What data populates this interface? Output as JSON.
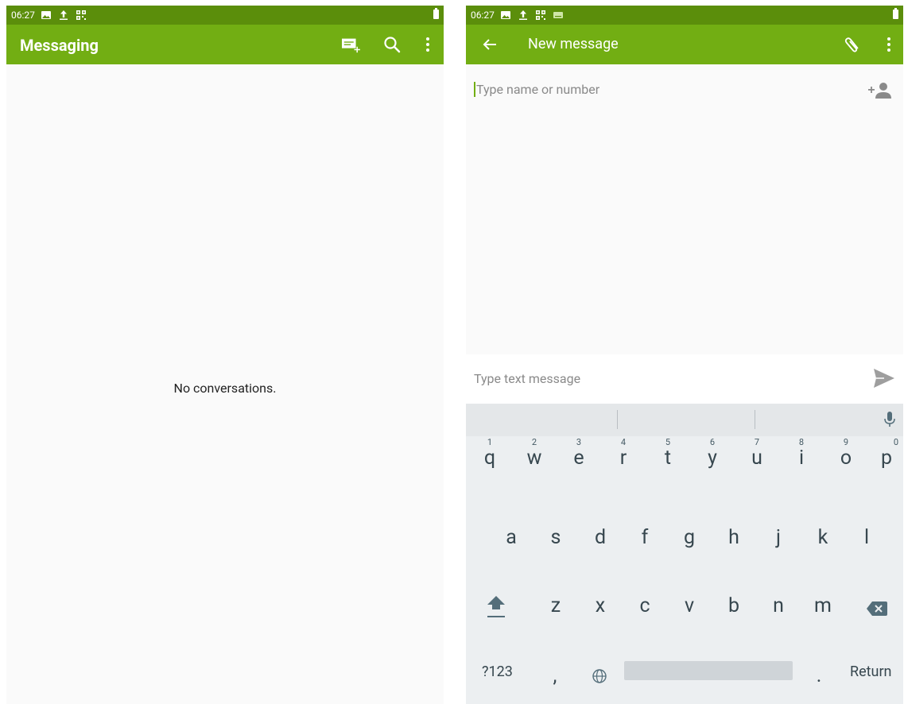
{
  "left": {
    "status": {
      "time": "06:27"
    },
    "appbar": {
      "title": "Messaging"
    },
    "empty_text": "No conversations."
  },
  "right": {
    "status": {
      "time": "06:27"
    },
    "appbar": {
      "title": "New message"
    },
    "recipient_placeholder": "Type name or number",
    "message_placeholder": "Type text message",
    "keyboard": {
      "row1": [
        {
          "key": "q",
          "hint": "1"
        },
        {
          "key": "w",
          "hint": "2"
        },
        {
          "key": "e",
          "hint": "3"
        },
        {
          "key": "r",
          "hint": "4"
        },
        {
          "key": "t",
          "hint": "5"
        },
        {
          "key": "y",
          "hint": "6"
        },
        {
          "key": "u",
          "hint": "7"
        },
        {
          "key": "i",
          "hint": "8"
        },
        {
          "key": "o",
          "hint": "9"
        },
        {
          "key": "p",
          "hint": "0"
        }
      ],
      "row2": [
        "a",
        "s",
        "d",
        "f",
        "g",
        "h",
        "j",
        "k",
        "l"
      ],
      "row3": [
        "z",
        "x",
        "c",
        "v",
        "b",
        "n",
        "m"
      ],
      "row4": {
        "symbols": "?123",
        "comma": ",",
        "period": ".",
        "return": "Return"
      }
    }
  },
  "colors": {
    "appbar": "#72ae13",
    "statusbar": "#5b8e0b",
    "accent": "#72ae13"
  }
}
